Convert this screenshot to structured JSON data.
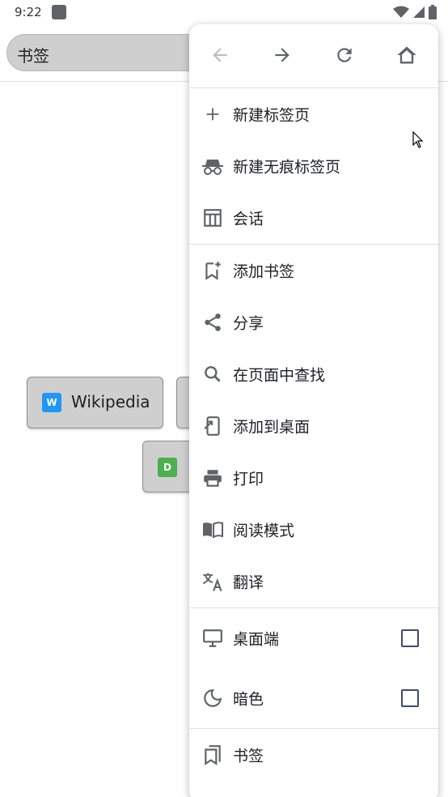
{
  "status": {
    "time": "9:22"
  },
  "address": {
    "text": "书签"
  },
  "tiles": [
    {
      "favicon": "W",
      "label": "Wikipedia",
      "color": "#2196f3"
    },
    {
      "favicon": "D",
      "label": "",
      "color": "#4caf50"
    }
  ],
  "menu": {
    "nav": [
      "back-icon",
      "forward-icon",
      "reload-icon",
      "home-icon"
    ],
    "items": {
      "new_tab": "新建标签页",
      "new_incognito": "新建无痕标签页",
      "sessions": "会话",
      "add_bookmark": "添加书签",
      "share": "分享",
      "find": "在页面中查找",
      "add_home": "添加到桌面",
      "print": "打印",
      "reader": "阅读模式",
      "translate": "翻译",
      "desktop": "桌面端",
      "dark": "暗色",
      "bookmarks": "书签"
    },
    "checkboxes": {
      "desktop": false,
      "dark": false
    }
  },
  "colors": {
    "menu_bg": "#ffffff",
    "tile_bg": "#cfcfcf",
    "icon": "#5f6368",
    "checkbox": "#3c4d6b"
  }
}
